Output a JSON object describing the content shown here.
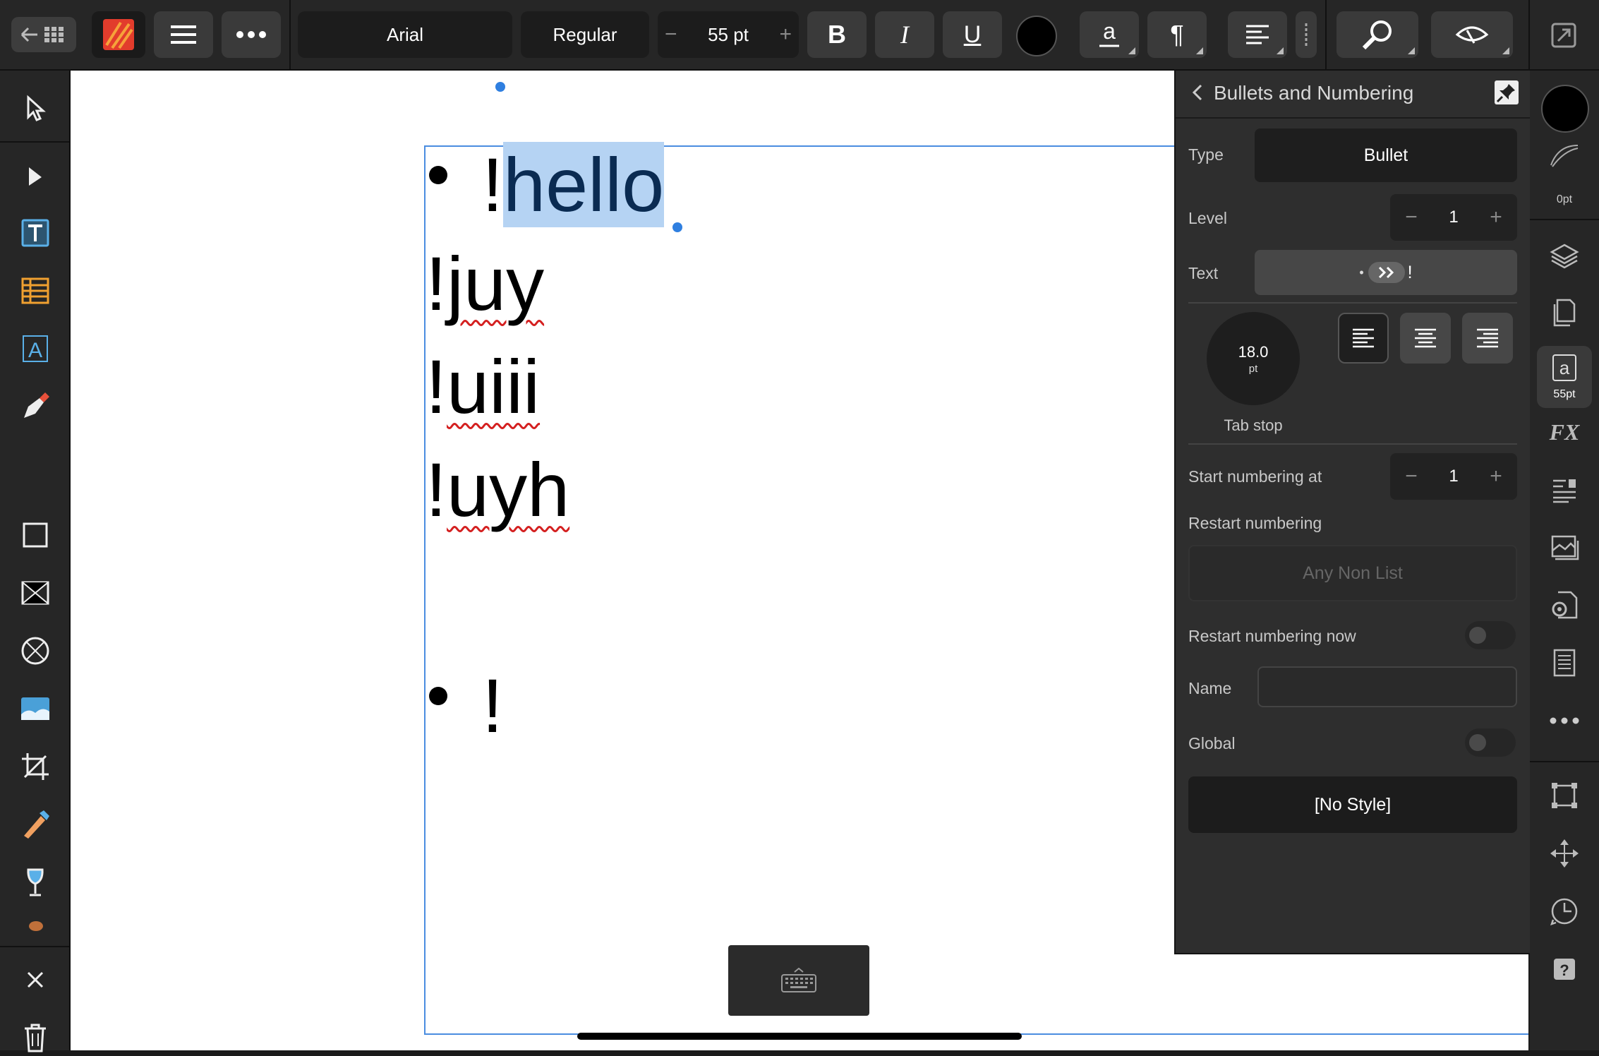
{
  "toolbar": {
    "font_name": "Arial",
    "font_style": "Regular",
    "font_size": "55 pt",
    "minus": "−",
    "plus": "+",
    "bold": "B",
    "italic": "I",
    "underline": "U",
    "text_color": "#000000"
  },
  "document": {
    "lines": [
      {
        "bullet": true,
        "prefix": "!",
        "text": "hello",
        "selected": true
      },
      {
        "bullet": false,
        "prefix": "!",
        "text": "juy"
      },
      {
        "bullet": false,
        "prefix": "!",
        "text": "uiii"
      },
      {
        "bullet": false,
        "prefix": "!",
        "text": "uyh"
      },
      {
        "bullet": true,
        "prefix": "!",
        "text": ""
      }
    ]
  },
  "panel": {
    "title": "Bullets and Numbering",
    "type_label": "Type",
    "type_value": "Bullet",
    "level_label": "Level",
    "level_value": "1",
    "text_label": "Text",
    "text_value": "!",
    "tab_stop_value": "18.0",
    "tab_stop_unit": "pt",
    "tab_stop_label": "Tab stop",
    "start_numbering_label": "Start numbering at",
    "start_numbering_value": "1",
    "restart_numbering_label": "Restart numbering",
    "restart_numbering_value": "Any Non List",
    "restart_now_label": "Restart numbering now",
    "restart_now_on": false,
    "name_label": "Name",
    "name_value": "",
    "global_label": "Global",
    "global_on": false,
    "style_button": "[No Style]"
  },
  "right_strip": {
    "stroke_width": "0pt",
    "char_size": "55pt"
  },
  "colors": {
    "selection": "#b5d3f3",
    "accent": "#2f7fe0",
    "spell_error": "#d42020"
  }
}
